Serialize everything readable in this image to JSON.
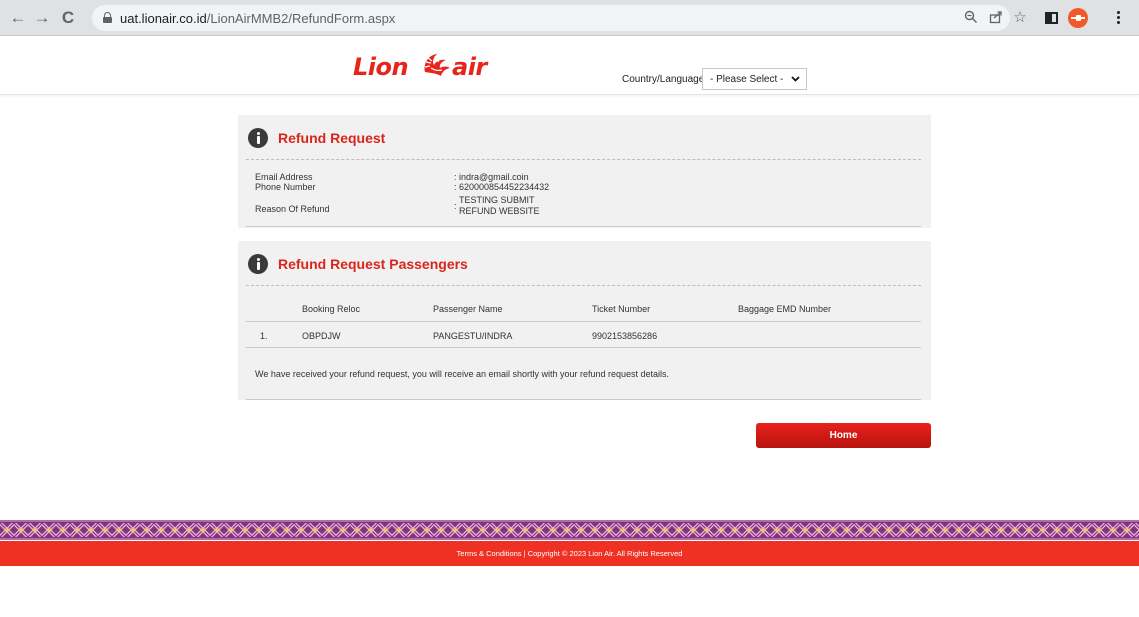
{
  "browser": {
    "url_host": "uat.lionair.co.id",
    "url_path": "/LionAirMMB2/RefundForm.aspx"
  },
  "header": {
    "logo_left": "Lion",
    "logo_right": "air",
    "country_label": "Country/Language",
    "country_select_value": "- Please Select -"
  },
  "refund": {
    "title": "Refund Request",
    "fields": [
      {
        "label": "Email Address",
        "value": "indra@gmail.coin"
      },
      {
        "label": "Phone Number",
        "value": "620000854452234432"
      },
      {
        "label": "Reason Of Refund",
        "value_line1": "TESTING SUBMIT",
        "value_line2": "REFUND WEBSITE"
      }
    ]
  },
  "passengers": {
    "title": "Refund Request Passengers",
    "columns": [
      "Booking Reloc",
      "Passenger Name",
      "Ticket Number",
      "Baggage EMD Number"
    ],
    "rows": [
      {
        "no": "1.",
        "booking_reloc": "OBPDJW",
        "passenger_name": "PANGESTU/INDRA",
        "ticket_number": "9902153856286",
        "baggage_emd": ""
      }
    ],
    "note": "We have received your refund request, you will receive an email shortly with your refund request details."
  },
  "home_button": "Home",
  "footer": {
    "terms": "Terms & Conditions",
    "separator": " | ",
    "copyright": "Copyright © 2023 Lion Air. All Rights Reserved"
  },
  "colors": {
    "brand_red": "#e8251c",
    "title_red": "#d9261c",
    "footer_red": "#ef3124",
    "footer_pattern_purple": "#7d3778"
  },
  "icons": [
    "back-icon",
    "forward-icon",
    "reload-icon",
    "lock-icon",
    "zoom-icon",
    "share-icon",
    "star-icon",
    "side-panel-icon",
    "profile-icon",
    "menu-icon",
    "info-icon",
    "chevron-down-icon"
  ]
}
